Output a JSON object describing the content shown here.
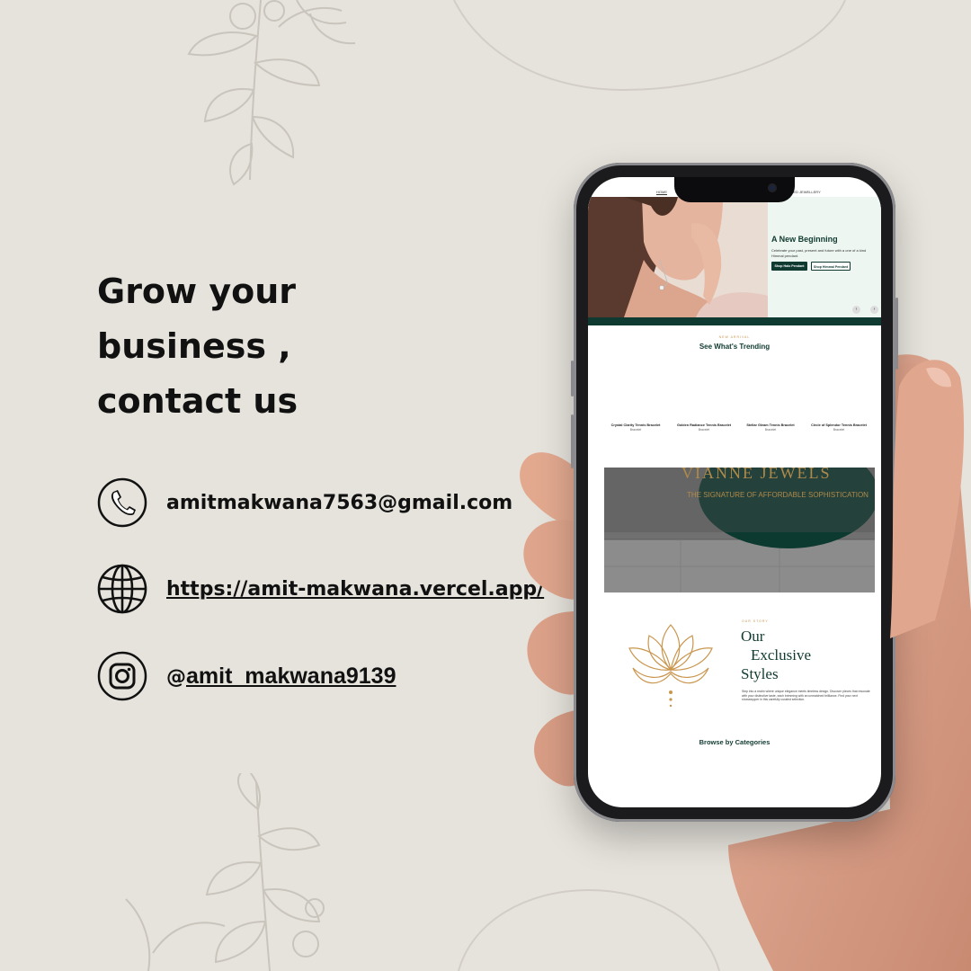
{
  "headline": {
    "line1": "Grow your",
    "line2": "business ,",
    "line3": "contact us"
  },
  "contact": {
    "email": "amitmakwana7563@gmail.com",
    "website": "https://amit-makwana.vercel.app/",
    "instagram_prefix": "@",
    "instagram_handle": "amit_makwana9139"
  },
  "icons": {
    "phone": "phone-icon",
    "website": "globe-icon",
    "instagram": "instagram-icon"
  },
  "phone_site": {
    "nav": {
      "home": "HOME",
      "item": "TOMIZED JEWELLERY"
    },
    "hero": {
      "title": "A New Beginning",
      "subtitle": "Celebrate your past, present and future with a one of a kind Himmal pendant.",
      "primary_button": "Shop Halo Pendant",
      "secondary_button": "Shop Himmal Pendant",
      "prev": "‹",
      "next": "›"
    },
    "trending": {
      "eyebrow": "NEW ARRIVAL",
      "title": "See What's Trending",
      "products": [
        {
          "name": "Crystal Clarity Tennis Bracelet",
          "category": "Bracelet"
        },
        {
          "name": "Golden Radiance Tennis Bracelet",
          "category": "Bracelet"
        },
        {
          "name": "Stellar Gleam Tennis Bracelet",
          "category": "Bracelet"
        },
        {
          "name": "Circle of Splendor Tennis Bracelet",
          "category": "Bracelet"
        }
      ]
    },
    "banner": {
      "brand": "VIANNE JEWELS",
      "tagline": "THE SIGNATURE OF AFFORDABLE SOPHISTICATION"
    },
    "story": {
      "eyebrow": "OUR STORY",
      "title_line1": "Our",
      "title_line2": "Exclusive",
      "title_line3": "Styles",
      "text": "Step into a realm where unique elegance meets timeless design. Discover pieces that resonate with your distinctive taste, each brimming with an unmatched brilliance. Find your next showstopper in this carefully curated selection."
    },
    "categories_title": "Browse by Categories"
  },
  "colors": {
    "background": "#e6e3dc",
    "site_green": "#0f3a31",
    "gold": "#c9964e"
  }
}
